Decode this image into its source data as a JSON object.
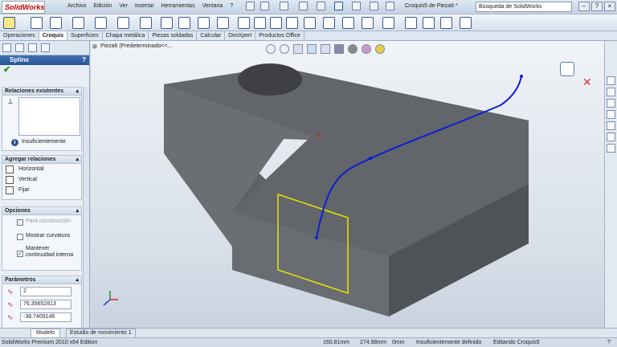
{
  "app": {
    "logo": "SolidWorks",
    "doc_title": "Croquis5 de Pieza6 *",
    "search_placeholder": "Búsqueda de SolidWorks",
    "menu": [
      "Archivo",
      "Edición",
      "Ver",
      "Insertar",
      "Herramientas",
      "Ventana",
      "?"
    ]
  },
  "command_tabs": [
    "Operaciones",
    "Croquis",
    "Superficies",
    "Chapa metálica",
    "Piezas soldadas",
    "Calcular",
    "DimXpert",
    "Productos Office"
  ],
  "property_manager": {
    "title": "Spline",
    "existing_relations": {
      "title": "Relaciones existentes",
      "status": "Insuficientemente"
    },
    "add_relations": {
      "title": "Agregar relaciones",
      "items": [
        "Horizontal",
        "Vertical",
        "Fijar"
      ]
    },
    "options": {
      "title": "Opciones",
      "items": [
        {
          "label": "Para construcción",
          "checked": false,
          "disabled": true
        },
        {
          "label": "Mostrar curvatura",
          "checked": false,
          "disabled": false
        },
        {
          "label": "Mantener continuidad interna",
          "checked": true,
          "disabled": false
        }
      ]
    },
    "parameters": {
      "title": "Parámetros",
      "values": [
        "2",
        "76,35652813",
        "-38.7409146"
      ]
    }
  },
  "viewport": {
    "tree_label": "Pieza6  (Predeterminado<<..."
  },
  "bottom_tabs": [
    "Modelo",
    "Estudio de movimiento 1"
  ],
  "status": {
    "edition": "SolidWorks Premium 2010 x64 Edition",
    "x": "160.81mm",
    "y": "274.98mm",
    "z": "0mm",
    "state": "Insuficientemente definido",
    "editing": "Editando Croquis5",
    "help": "?"
  },
  "colors": {
    "accent": "#2a5597",
    "sketch": "#0a1fd6",
    "selection": "#e6e600",
    "part": "#6b6e73"
  }
}
